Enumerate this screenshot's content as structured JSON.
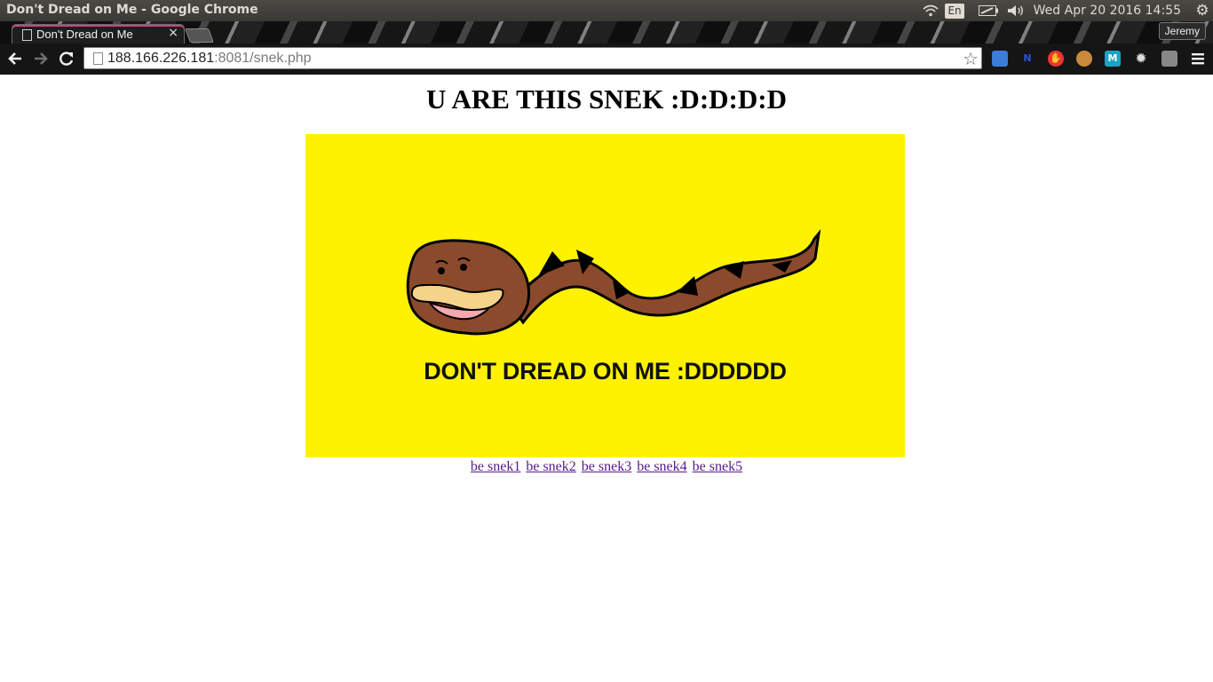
{
  "os_bar": {
    "window_title": "Don't Dread on Me - Google Chrome",
    "language": "En",
    "clock": "Wed Apr 20 2016 14:55"
  },
  "browser": {
    "tab_title": "Don't Dread on Me",
    "profile_name": "Jeremy",
    "url_host": "188.166.226.181",
    "url_rest": ":8081/snek.php",
    "extensions": [
      {
        "icon": "monitor-extension-icon",
        "label": ""
      },
      {
        "icon": "n-extension-icon",
        "label": "N"
      },
      {
        "icon": "adblock-stop-icon",
        "label": ""
      },
      {
        "icon": "cookie-icon",
        "label": ""
      },
      {
        "icon": "m-extension-icon",
        "label": "M"
      },
      {
        "icon": "bright-sun-icon",
        "label": ""
      },
      {
        "icon": "css-extension-icon",
        "label": ""
      }
    ]
  },
  "page": {
    "heading": "U ARE THIS SNEK :D:D:D:D",
    "flag_caption": "DON'T DREAD ON ME :DDDDDD",
    "links": [
      "be snek1",
      "be snek2",
      "be snek3",
      "be snek4",
      "be snek5"
    ]
  },
  "colors": {
    "flag_yellow": "#fff200",
    "snake_brown": "#8b4a2b",
    "link_visited": "#551a8b"
  }
}
